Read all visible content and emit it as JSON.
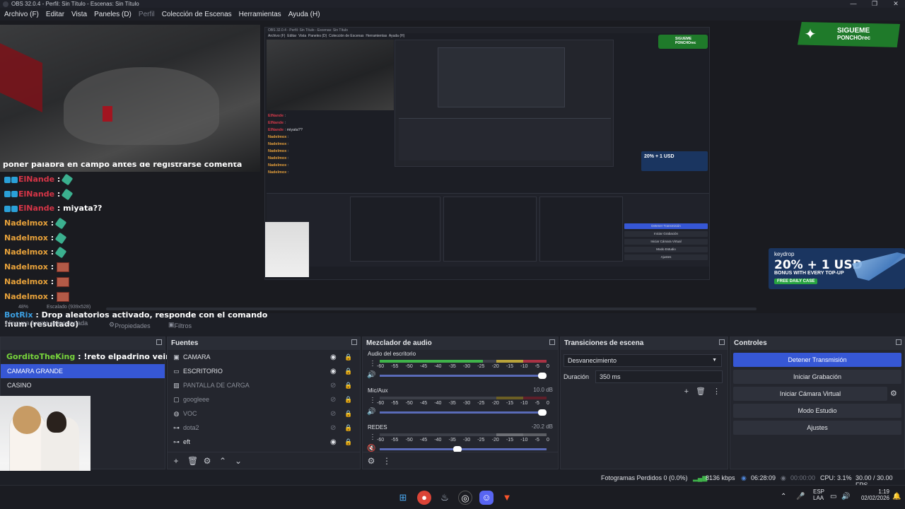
{
  "window": {
    "title": "OBS 32.0.4 - Perfil: Sin Título - Escenas: Sin Título",
    "controls": [
      "—",
      "❐",
      "✕"
    ]
  },
  "menu": [
    "Archivo (F)",
    "Editar",
    "Vista",
    "Paneles (D)",
    "Perfil",
    "Colección de Escenas",
    "Herramientas",
    "Ayuda (H)"
  ],
  "overlays": {
    "twitter": {
      "line1": "SIGUEME",
      "line2": "PONCHOrec"
    },
    "keydrop": {
      "brand": "keydrop",
      "headline": "20% + 1 USD",
      "bonus": "BONUS WITH EVERY TOP-UP",
      "free": "FREE DAILY CASE"
    }
  },
  "chat": [
    {
      "user": "ElNande",
      "msg": " :",
      "color": "red",
      "badge": true,
      "emote": "a"
    },
    {
      "user": "ElNande",
      "msg": " :",
      "color": "red",
      "badge": true,
      "emote": "a"
    },
    {
      "user": "ElNande",
      "msg": " : miyata??",
      "color": "red",
      "badge": true,
      "emote": ""
    },
    {
      "user": "Nadelmox",
      "msg": " :",
      "color": "org",
      "badge": false,
      "emote": "a"
    },
    {
      "user": "Nadelmox",
      "msg": " :",
      "color": "org",
      "badge": false,
      "emote": "a"
    },
    {
      "user": "Nadelmox",
      "msg": " :",
      "color": "org",
      "badge": false,
      "emote": "a"
    },
    {
      "user": "Nadelmox",
      "msg": " :",
      "color": "org",
      "badge": false,
      "emote": "b"
    },
    {
      "user": "Nadelmox",
      "msg": " :",
      "color": "org",
      "badge": false,
      "emote": "b"
    },
    {
      "user": "Nadelmox",
      "msg": " :",
      "color": "org",
      "badge": false,
      "emote": "b"
    }
  ],
  "chat_cut": "poner palabra en campo antes de registrarse comenta",
  "botrix": {
    "name": "BotRix",
    "msg": " : Drop aleatorios activado, responde con el comando",
    "line2": "!num (resultado)"
  },
  "scale": {
    "zoom": "48%",
    "label": "Escalado (939x528)"
  },
  "subbar": {
    "no_source": "Ninguna fuente seleccionada",
    "properties": "Propiedades",
    "filters": "Filtros"
  },
  "docks": {
    "scenes": {
      "chat_line": {
        "user": "GorditoTheKing",
        "msg": " : !reto elpadrino veinte minutos"
      },
      "items": [
        "CAMARA GRANDE",
        "CASINO"
      ],
      "selected": 0
    },
    "sources": {
      "title": "Fuentes",
      "items": [
        {
          "label": "CAMARA",
          "icon": "camera",
          "visible": true
        },
        {
          "label": "ESCRITORIO",
          "icon": "monitor",
          "visible": true
        },
        {
          "label": "PANTALLA DE CARGA",
          "icon": "image",
          "visible": false
        },
        {
          "label": "googleee",
          "icon": "window",
          "visible": false
        },
        {
          "label": "VOC",
          "icon": "browser",
          "visible": false
        },
        {
          "label": "dota2",
          "icon": "game",
          "visible": false
        },
        {
          "label": "eft",
          "icon": "game",
          "visible": true
        }
      ]
    },
    "mixer": {
      "title": "Mezclador de audio",
      "ticks": [
        "-60",
        "-55",
        "-50",
        "-45",
        "-40",
        "-35",
        "-30",
        "-25",
        "-20",
        "-15",
        "-10",
        "-5",
        "0"
      ],
      "channels": [
        {
          "name": "Audio del escritorio",
          "db": "",
          "level": 0.62,
          "vol": 1.0
        },
        {
          "name": "Mic/Aux",
          "db": "10.0 dB",
          "level": 0.0,
          "vol": 1.0
        },
        {
          "name": "REDES",
          "db": "-20.2 dB",
          "level": 0.0,
          "vol": 0.49
        }
      ]
    },
    "transitions": {
      "title": "Transiciones de escena",
      "selected": "Desvanecimiento",
      "duration_label": "Duración",
      "duration": "350 ms"
    },
    "controls": {
      "title": "Controles",
      "buttons": [
        "Detener Transmisión",
        "Iniciar Grabación",
        "Iniciar Cámara Virtual",
        "Modo Estudio",
        "Ajustes"
      ]
    }
  },
  "status": {
    "frames": "Fotogramas Perdidos 0 (0.0%)",
    "bitrate": "8136 kbps",
    "stream_time": "06:28:09",
    "rec_time": "00:00:00",
    "cpu": "CPU: 3.1%",
    "fps": "30.00 / 30.00 FPS"
  },
  "taskbar": {
    "lang1": "ESP",
    "lang2": "LAA",
    "time": "1:19",
    "date": "02/02/2026"
  },
  "colors": {
    "accent": "#3657d5",
    "meter_green": "#3fb24a",
    "meter_red": "#a83244"
  }
}
